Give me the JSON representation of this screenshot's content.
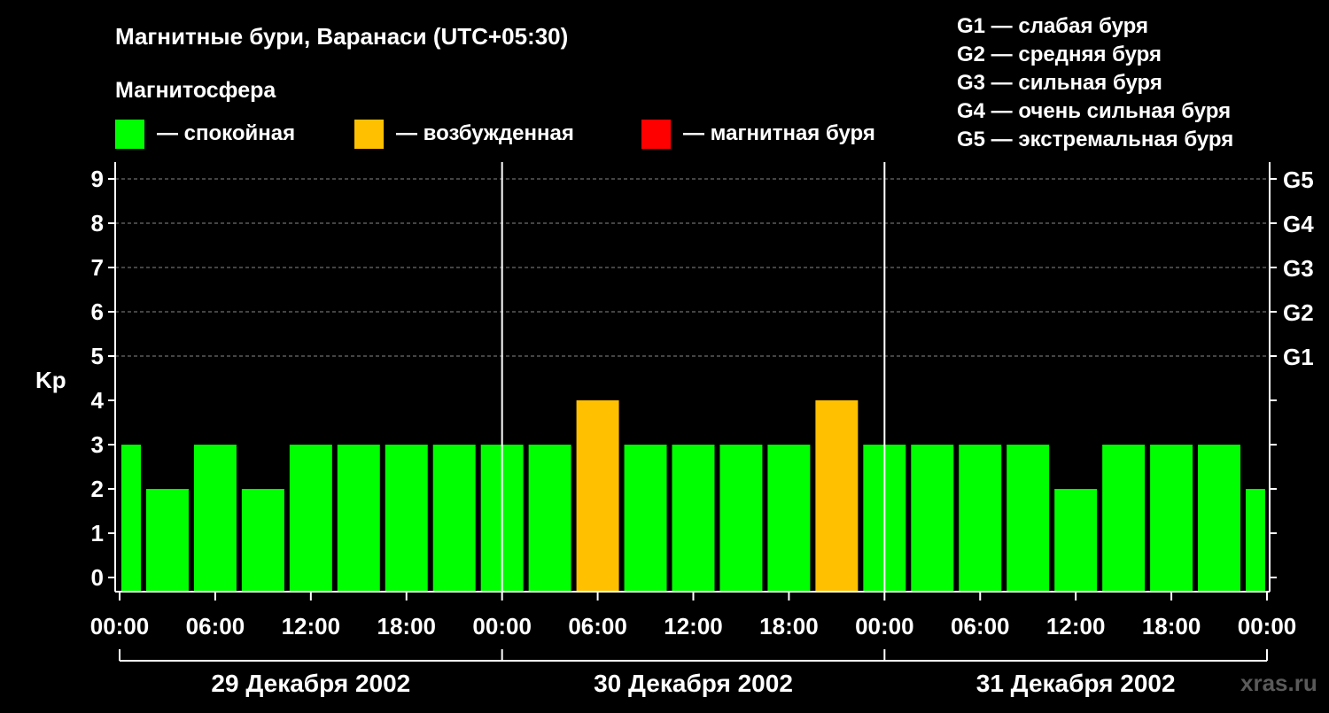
{
  "title": "Магнитные бури, Варанаси (UTC+05:30)",
  "subtitle": "Магнитосфера",
  "legend": [
    {
      "label": "— спокойная",
      "color": "#00ff00"
    },
    {
      "label": "— возбужденная",
      "color": "#ffc000"
    },
    {
      "label": "— магнитная буря",
      "color": "#ff0000"
    }
  ],
  "g_scale": [
    "G1 — слабая буря",
    "G2 — средняя буря",
    "G3 — сильная буря",
    "G4 — очень сильная буря",
    "G5 — экстремальная буря"
  ],
  "watermark": "xras.ru",
  "colors": {
    "quiet": "#00ff00",
    "active": "#ffc000",
    "storm": "#ff0000",
    "background": "#000000"
  },
  "chart_data": {
    "type": "bar",
    "ylabel": "Kp",
    "ylim": [
      0,
      9
    ],
    "yticks": [
      0,
      1,
      2,
      3,
      4,
      5,
      6,
      7,
      8,
      9
    ],
    "right_axis_labels": [
      {
        "kp": 5,
        "label": "G1"
      },
      {
        "kp": 6,
        "label": "G2"
      },
      {
        "kp": 7,
        "label": "G3"
      },
      {
        "kp": 8,
        "label": "G4"
      },
      {
        "kp": 9,
        "label": "G5"
      }
    ],
    "x_tick_labels": [
      "00:00",
      "06:00",
      "12:00",
      "18:00",
      "00:00",
      "06:00",
      "12:00",
      "18:00",
      "00:00",
      "06:00",
      "12:00",
      "18:00",
      "00:00"
    ],
    "days": [
      "29 Декабря 2002",
      "30 Декабря 2002",
      "31 Декабря 2002"
    ],
    "grid": "dashed horizontal at 5-9",
    "series": [
      {
        "values": [
          3,
          2,
          3,
          2,
          3,
          3,
          3,
          3,
          3,
          3,
          4,
          3,
          3,
          3,
          3,
          4,
          3,
          3,
          3,
          3,
          2,
          3,
          3,
          3,
          2
        ],
        "start_hour": [
          -1.5,
          1.5,
          4.5,
          7.5,
          10.5,
          13.5,
          16.5,
          19.5,
          22.5,
          25.5,
          28.5,
          31.5,
          34.5,
          37.5,
          40.5,
          43.5,
          46.5,
          49.5,
          52.5,
          55.5,
          58.5,
          61.5,
          64.5,
          67.5,
          70.5
        ],
        "duration_hours": 3,
        "x_range_hours": [
          0,
          72
        ],
        "status": [
          "quiet",
          "quiet",
          "quiet",
          "quiet",
          "quiet",
          "quiet",
          "quiet",
          "quiet",
          "quiet",
          "quiet",
          "active",
          "quiet",
          "quiet",
          "quiet",
          "quiet",
          "active",
          "quiet",
          "quiet",
          "quiet",
          "quiet",
          "quiet",
          "quiet",
          "quiet",
          "quiet",
          "quiet"
        ]
      }
    ]
  }
}
